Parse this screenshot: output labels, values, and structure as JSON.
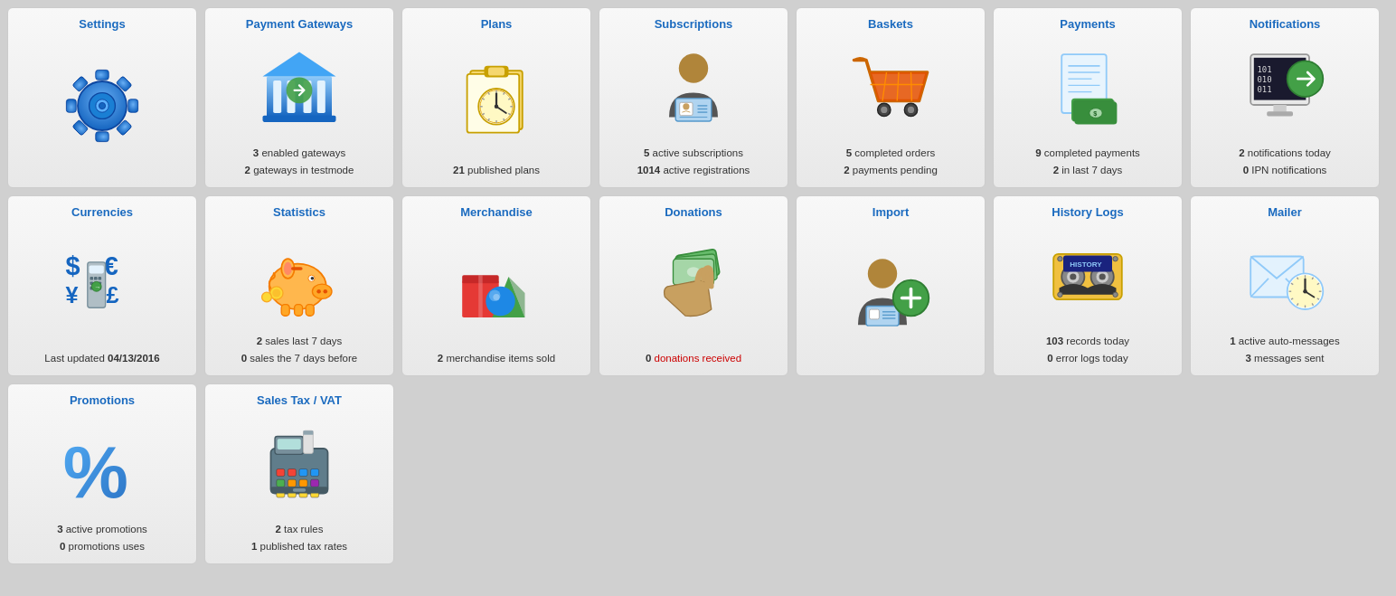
{
  "cards": [
    {
      "id": "settings",
      "title": "Settings",
      "icon": "gear",
      "stats": []
    },
    {
      "id": "payment-gateways",
      "title": "Payment Gateways",
      "icon": "bank",
      "stats": [
        {
          "num": "3",
          "text": " enabled gateways"
        },
        {
          "num": "2",
          "text": " gateways in testmode"
        }
      ]
    },
    {
      "id": "plans",
      "title": "Plans",
      "icon": "clipboard-clock",
      "stats": [
        {
          "num": "21",
          "text": " published plans"
        }
      ]
    },
    {
      "id": "subscriptions",
      "title": "Subscriptions",
      "icon": "person-card",
      "stats": [
        {
          "num": "5",
          "text": " active subscriptions"
        },
        {
          "num": "1014",
          "text": " active registrations"
        }
      ]
    },
    {
      "id": "baskets",
      "title": "Baskets",
      "icon": "cart",
      "stats": [
        {
          "num": "5",
          "text": " completed orders"
        },
        {
          "num": "2",
          "text": " payments pending"
        }
      ]
    },
    {
      "id": "payments",
      "title": "Payments",
      "icon": "invoice",
      "stats": [
        {
          "num": "9",
          "text": " completed payments"
        },
        {
          "num": "2",
          "text": " in last 7 days"
        }
      ]
    },
    {
      "id": "notifications",
      "title": "Notifications",
      "icon": "binary-arrow",
      "stats": [
        {
          "num": "2",
          "text": " notifications today"
        },
        {
          "num": "0",
          "text": " IPN notifications"
        }
      ]
    },
    {
      "id": "currencies",
      "title": "Currencies",
      "icon": "currencies",
      "stats": [
        {
          "special": "last-updated",
          "text": "Last updated ",
          "bold": "04/13/2016"
        }
      ]
    },
    {
      "id": "statistics",
      "title": "Statistics",
      "icon": "piggy-bank",
      "stats": [
        {
          "num": "2",
          "text": " sales last 7 days"
        },
        {
          "num": "0",
          "text": " sales the 7 days before"
        }
      ]
    },
    {
      "id": "merchandise",
      "title": "Merchandise",
      "icon": "merchandise",
      "stats": [
        {
          "num": "2",
          "text": " merchandise items sold"
        }
      ]
    },
    {
      "id": "donations",
      "title": "Donations",
      "icon": "hand-money",
      "stats": [
        {
          "num": "0",
          "text": " donations received",
          "red": true
        }
      ]
    },
    {
      "id": "import",
      "title": "Import",
      "icon": "person-plus",
      "stats": []
    },
    {
      "id": "history-logs",
      "title": "History Logs",
      "icon": "cassette",
      "stats": [
        {
          "num": "103",
          "text": " records today"
        },
        {
          "num": "0",
          "text": " error logs today"
        }
      ]
    },
    {
      "id": "mailer",
      "title": "Mailer",
      "icon": "mail-clock",
      "stats": [
        {
          "num": "1",
          "text": " active auto-messages"
        },
        {
          "num": "3",
          "text": " messages sent"
        }
      ]
    },
    {
      "id": "promotions",
      "title": "Promotions",
      "icon": "percent",
      "stats": [
        {
          "num": "3",
          "text": " active promotions"
        },
        {
          "num": "0",
          "text": " promotions uses"
        }
      ]
    },
    {
      "id": "sales-tax",
      "title": "Sales Tax / VAT",
      "icon": "register",
      "stats": [
        {
          "num": "2",
          "text": " tax rules"
        },
        {
          "num": "1",
          "text": " published tax rates"
        }
      ]
    }
  ]
}
